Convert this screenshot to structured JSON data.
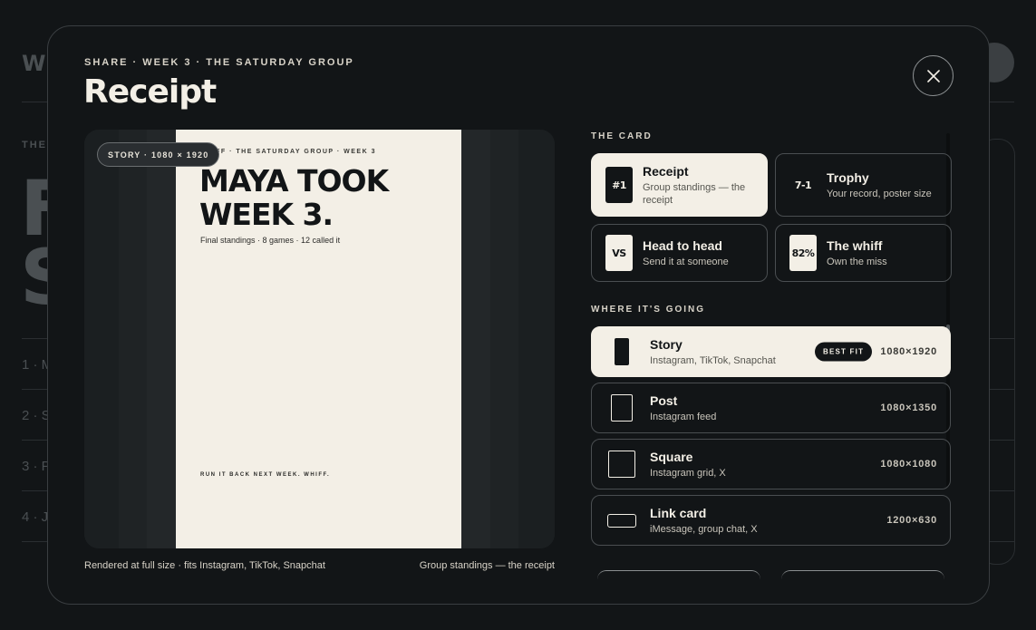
{
  "background": {
    "brand": "WH",
    "kicker": "THE S",
    "big_lines": [
      "F",
      "S"
    ],
    "list_items": [
      "1 · M",
      "2 · S",
      "3 · P",
      "4 · J"
    ]
  },
  "modal": {
    "kicker": "SHARE · WEEK 3 · THE SATURDAY GROUP",
    "title": "Receipt",
    "close_icon": "close-icon"
  },
  "preview": {
    "size_pill": "STORY · 1080 × 1920",
    "paper": {
      "kicker": "WHIFF · THE SATURDAY GROUP · WEEK 3",
      "headline_line1": "MAYA TOOK",
      "headline_line2": "WEEK 3.",
      "subline": "Final standings · 8 games · 12 called it",
      "footer": "RUN IT BACK NEXT WEEK. WHIFF."
    },
    "caption_left": "Rendered at full size · fits Instagram, TikTok, Snapchat",
    "caption_right": "Group standings — the receipt"
  },
  "cards_section": {
    "label": "THE CARD",
    "items": [
      {
        "badge": "#1",
        "name": "Receipt",
        "desc": "Group standings — the receipt",
        "selected": true
      },
      {
        "badge": "7-1",
        "name": "Trophy",
        "desc": "Your record, poster size",
        "selected": false
      },
      {
        "badge": "VS",
        "name": "Head to head",
        "desc": "Send it at someone",
        "selected": false
      },
      {
        "badge": "82%",
        "name": "The whiff",
        "desc": "Own the miss",
        "selected": false
      }
    ]
  },
  "destinations_section": {
    "label": "WHERE IT'S GOING",
    "items": [
      {
        "name": "Story",
        "desc": "Instagram, TikTok, Snapchat",
        "size": "1080×1920",
        "badge": "BEST FIT",
        "selected": true
      },
      {
        "name": "Post",
        "desc": "Instagram feed",
        "size": "1080×1350",
        "selected": false
      },
      {
        "name": "Square",
        "desc": "Instagram grid, X",
        "size": "1080×1080",
        "selected": false
      },
      {
        "name": "Link card",
        "desc": "iMessage, group chat, X",
        "size": "1200×630",
        "selected": false
      }
    ]
  },
  "colors": {
    "background": "#121517",
    "paper": "#f3efe6",
    "border": "#4a4e51"
  }
}
